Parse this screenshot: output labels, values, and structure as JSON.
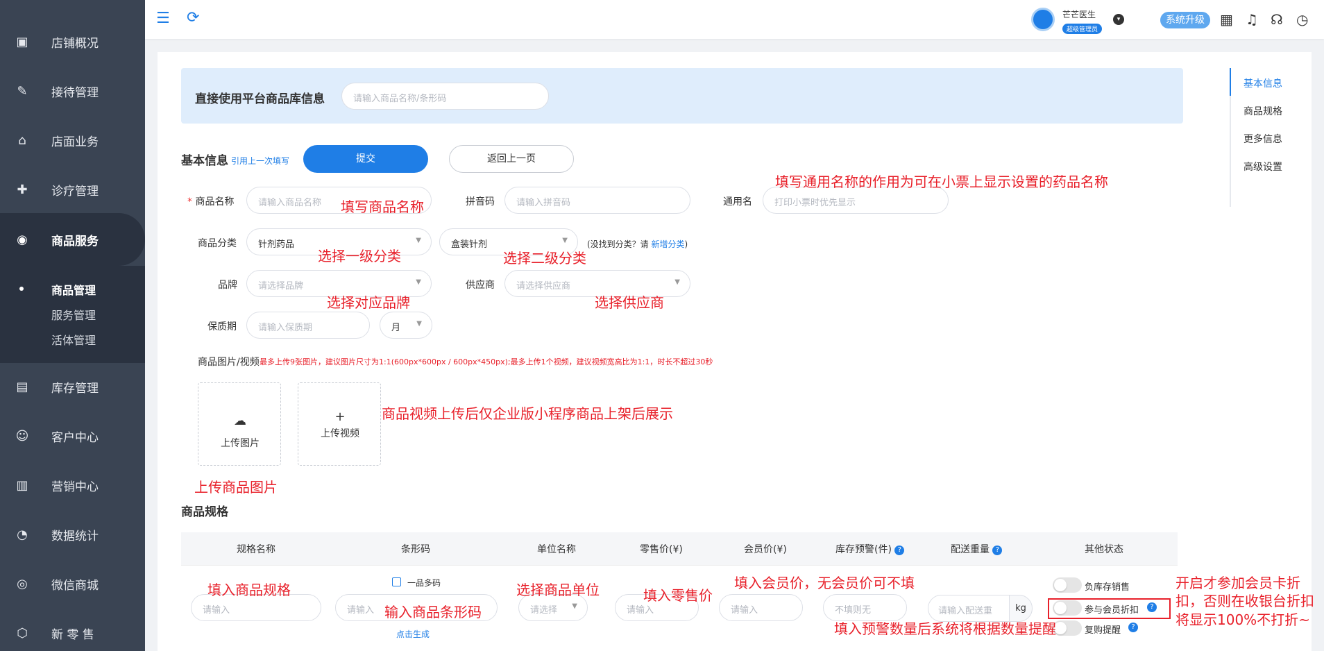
{
  "sidebar": {
    "items": [
      {
        "label": "店铺概况",
        "icon": "store-overview-icon"
      },
      {
        "label": "接待管理",
        "icon": "reception-icon"
      },
      {
        "label": "店面业务",
        "icon": "store-business-icon"
      },
      {
        "label": "诊疗管理",
        "icon": "medical-icon"
      },
      {
        "label": "商品服务",
        "icon": "goods-service-icon"
      },
      {
        "label": "库存管理",
        "icon": "inventory-icon"
      },
      {
        "label": "客户中心",
        "icon": "customer-icon"
      },
      {
        "label": "营销中心",
        "icon": "marketing-icon"
      },
      {
        "label": "数据统计",
        "icon": "stats-icon"
      },
      {
        "label": "微信商城",
        "icon": "wechat-mall-icon"
      },
      {
        "label": "新 零 售",
        "icon": "new-retail-icon"
      }
    ],
    "sub_items": [
      "商品管理",
      "服务管理",
      "活体管理"
    ]
  },
  "header": {
    "user_name": "芒芒医生",
    "user_role": "超级管理员",
    "upgrade_label": "系统升级"
  },
  "library": {
    "title": "直接使用平台商品库信息",
    "search_placeholder": "请输入商品名称/条形码"
  },
  "basic": {
    "title": "基本信息",
    "reuse_link": "引用上一次填写",
    "submit_label": "提交",
    "back_label": "返回上一页",
    "name_label": "商品名称",
    "name_placeholder": "请输入商品名称",
    "pinyin_label": "拼音码",
    "pinyin_placeholder": "请输入拼音码",
    "common_label": "通用名",
    "common_placeholder": "打印小票时优先显示",
    "category_label": "商品分类",
    "category1_value": "针剂药品",
    "category2_value": "盒装针剂",
    "category_hint_prefix": "(没找到分类？请",
    "category_hint_link": "新增分类",
    "category_hint_suffix": ")",
    "brand_label": "品牌",
    "brand_placeholder": "请选择品牌",
    "supplier_label": "供应商",
    "supplier_placeholder": "请选择供应商",
    "shelf_label": "保质期",
    "shelf_placeholder": "请输入保质期",
    "shelf_unit": "月",
    "media_label": "商品图片/视频",
    "media_hint": "最多上传9张图片，建议图片尺寸为1:1(600px*600px / 600px*450px);最多上传1个视频，建议视频宽高比为1:1，时长不超过30秒",
    "upload_image": "上传图片",
    "upload_video": "上传视频"
  },
  "annotations": {
    "fill_name": "填写商品名称",
    "common_name": "填写通用名称的作用为可在小票上显示设置的药品名称",
    "cat1": "选择一级分类",
    "cat2": "选择二级分类",
    "brand": "选择对应品牌",
    "supplier": "选择供应商",
    "video": "商品视频上传后仅企业版小程序商品上架后展示",
    "image": "上传商品图片",
    "spec": "填入商品规格",
    "unit": "选择商品单位",
    "barcode": "输入商品条形码",
    "retail": "填入零售价",
    "member": "填入会员价，无会员价可不填",
    "warn": "填入预警数量后系统将根据数量提醒",
    "member_discount_1": "开启才参加会员卡折",
    "member_discount_2": "扣，否则在收银台折扣",
    "member_discount_3": "将显示100%不打折~"
  },
  "spec": {
    "title": "商品规格",
    "headers": [
      "规格名称",
      "条形码",
      "单位名称",
      "零售价(¥)",
      "会员价(¥)",
      "库存预警(件)",
      "配送重量",
      "其他状态"
    ],
    "spec_placeholder": "请输入",
    "barcode_placeholder": "请输入",
    "multi_code_label": "一品多码",
    "generate_link": "点击生成",
    "unit_placeholder": "请选择",
    "retail_placeholder": "请输入",
    "member_placeholder": "请输入",
    "warn_placeholder": "不填则无",
    "weight_placeholder": "请输入配送重",
    "weight_unit": "kg",
    "toggle_negative": "负库存销售",
    "toggle_member": "参与会员折扣",
    "toggle_repurchase": "复购提醒"
  },
  "anchors": [
    "基本信息",
    "商品规格",
    "更多信息",
    "高级设置"
  ]
}
